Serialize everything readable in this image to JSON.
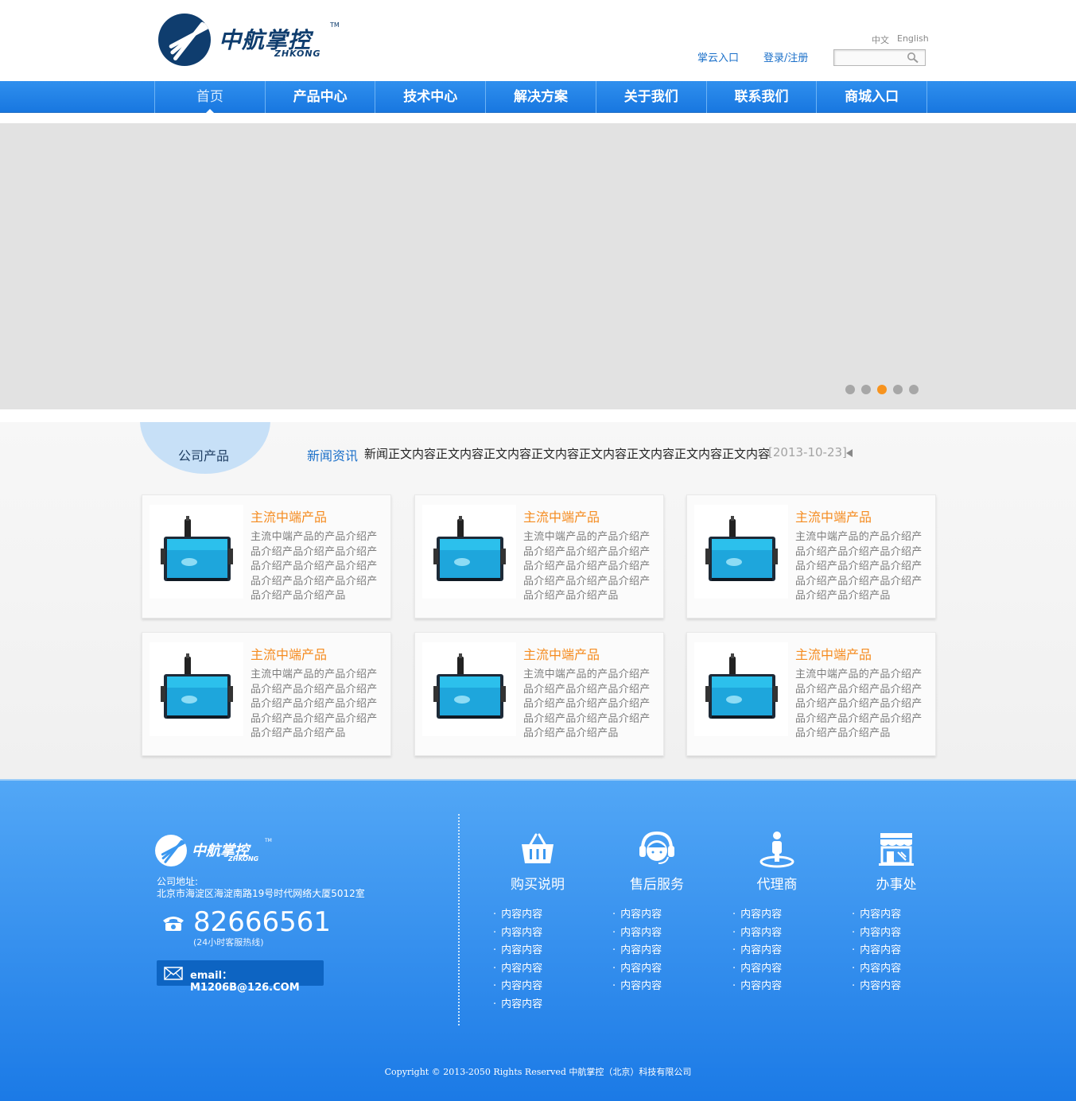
{
  "header": {
    "logo_text": "中航掌控",
    "logo_sub": "ZHKONG",
    "logo_tm": "TM",
    "lang_zh": "中文",
    "lang_en": "English",
    "link_cloud": "掌云入口",
    "link_login": "登录/注册",
    "search_placeholder": ""
  },
  "nav": {
    "items": [
      {
        "label": "首页",
        "active": true
      },
      {
        "label": "产品中心"
      },
      {
        "label": "技术中心"
      },
      {
        "label": "解决方案"
      },
      {
        "label": "关于我们"
      },
      {
        "label": "联系我们"
      },
      {
        "label": "商城入口"
      }
    ]
  },
  "banner": {
    "slides": 5,
    "active_slide": 3,
    "colors": {
      "dot": "#a7a7a7",
      "dot_active": "#f7931e"
    }
  },
  "content": {
    "tab_company": "公司产品",
    "news_label": "新闻资讯",
    "news_text": "新闻正文内容正文内容正文内容正文内容正文内容正文内容正文内容正文内容",
    "news_date": "[2013-10-23]",
    "products": [
      {
        "title": "主流中端产品",
        "desc": "主流中端产品的产品介绍产品介绍产品介绍产品介绍产品介绍产品介绍产品介绍产品介绍产品介绍产品介绍产品介绍产品介绍产品"
      },
      {
        "title": "主流中端产品",
        "desc": "主流中端产品的产品介绍产品介绍产品介绍产品介绍产品介绍产品介绍产品介绍产品介绍产品介绍产品介绍产品介绍产品介绍产品"
      },
      {
        "title": "主流中端产品",
        "desc": "主流中端产品的产品介绍产品介绍产品介绍产品介绍产品介绍产品介绍产品介绍产品介绍产品介绍产品介绍产品介绍产品介绍产品"
      },
      {
        "title": "主流中端产品",
        "desc": "主流中端产品的产品介绍产品介绍产品介绍产品介绍产品介绍产品介绍产品介绍产品介绍产品介绍产品介绍产品介绍产品介绍产品"
      },
      {
        "title": "主流中端产品",
        "desc": "主流中端产品的产品介绍产品介绍产品介绍产品介绍产品介绍产品介绍产品介绍产品介绍产品介绍产品介绍产品介绍产品介绍产品"
      },
      {
        "title": "主流中端产品",
        "desc": "主流中端产品的产品介绍产品介绍产品介绍产品介绍产品介绍产品介绍产品介绍产品介绍产品介绍产品介绍产品介绍产品介绍产品"
      }
    ]
  },
  "footer": {
    "logo_text": "中航掌控",
    "logo_sub": "ZHKONG",
    "logo_tm": "TM",
    "addr_label": "公司地址:",
    "addr_value": "北京市海淀区海淀南路19号时代网络大厦5012室",
    "phone": "82666561",
    "phone_note": "(24小时客服热线)",
    "email": "email：M1206B@126.COM",
    "columns": [
      {
        "title": "购买说明",
        "icon": "basket-icon",
        "items": [
          "内容内容",
          "内容内容",
          "内容内容",
          "内容内容",
          "内容内容",
          "内容内容"
        ]
      },
      {
        "title": "售后服务",
        "icon": "headset-icon",
        "items": [
          "内容内容",
          "内容内容",
          "内容内容",
          "内容内容",
          "内容内容"
        ]
      },
      {
        "title": "代理商",
        "icon": "person-pin-icon",
        "items": [
          "内容内容",
          "内容内容",
          "内容内容",
          "内容内容",
          "内容内容"
        ]
      },
      {
        "title": "办事处",
        "icon": "store-icon",
        "items": [
          "内容内容",
          "内容内容",
          "内容内容",
          "内容内容",
          "内容内容"
        ]
      }
    ],
    "copyright": "Copyright © 2013-2050 Rights Reserved  中航掌控（北京）科技有限公司"
  },
  "colors": {
    "nav_blue": "#1f82e8",
    "brand_navy": "#0f3d6e",
    "accent_orange": "#f58b1f",
    "link_blue": "#1a6fc9"
  }
}
